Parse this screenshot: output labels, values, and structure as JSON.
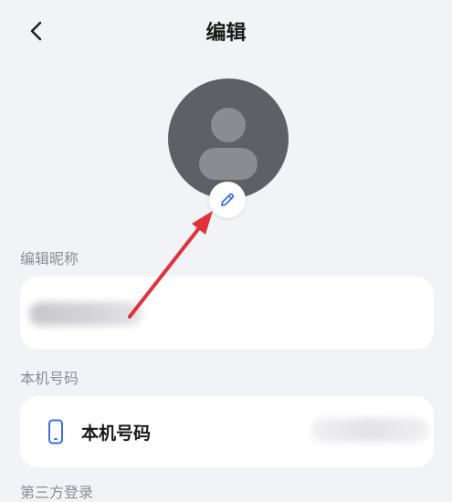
{
  "header": {
    "back_icon": "chevron-left-icon",
    "title": "编辑"
  },
  "avatar": {
    "icon": "person-silhouette-icon",
    "edit_icon": "pencil-icon",
    "accent": "#3b6fe0"
  },
  "sections": {
    "nickname_label": "编辑昵称",
    "phone_label": "本机号码",
    "third_party_label": "第三方登录"
  },
  "phone": {
    "icon": "phone-icon",
    "label": "本机号码"
  },
  "annotation": {
    "arrow_color": "#e0323c"
  }
}
